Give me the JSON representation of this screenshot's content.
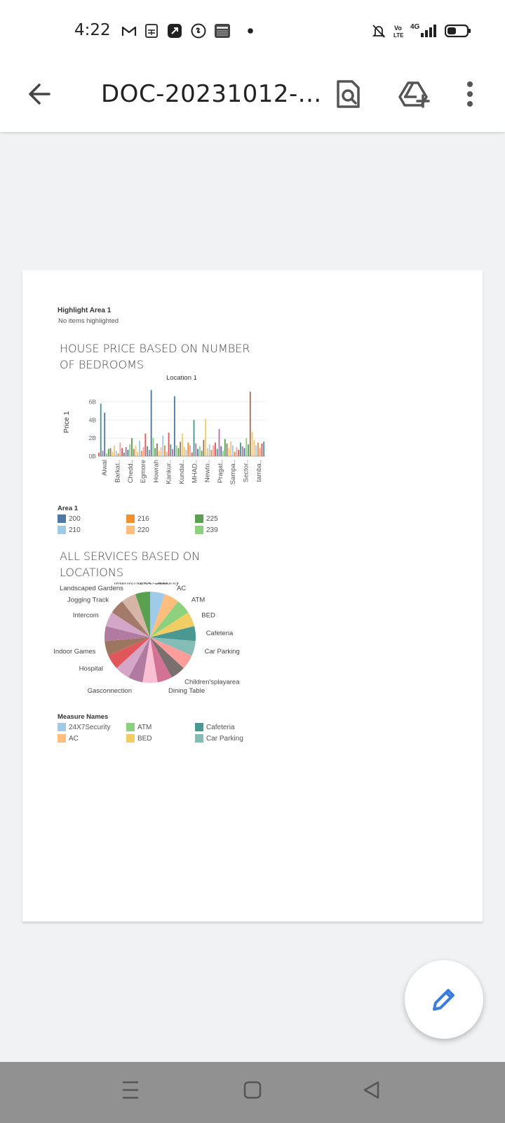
{
  "status_bar": {
    "time": "4:22",
    "network": "4G",
    "left_icons": [
      "gmail-icon",
      "sheets-icon",
      "app-icon",
      "shazam-icon",
      "news-icon",
      "dot-icon"
    ],
    "right_icons": [
      "mute-icon",
      "volte-icon",
      "signal-icon",
      "battery-icon"
    ]
  },
  "app_bar": {
    "title": "DOC-20231012-..."
  },
  "document": {
    "highlight": {
      "title": "Highlight Area 1",
      "subtitle": "No items highlighted"
    },
    "chart1_title": "HOUSE PRICE BASED ON NUMBER OF BEDROOMS",
    "chart2_title": "ALL SERVICES BASED ON LOCATIONS"
  },
  "chart_data": [
    {
      "type": "bar",
      "title": "Location 1",
      "ylabel": "Price 1",
      "y_ticks": [
        "0B",
        "2B",
        "4B",
        "6B"
      ],
      "ylim": [
        0,
        7.5
      ],
      "x_tick_labels": [
        "Alwal",
        "Barkat..",
        "Chedd..",
        "Egmore",
        "Howrah",
        "Kankur..",
        "Kundal..",
        "MHAD..",
        "Newto..",
        "Pragat..",
        "Sampa..",
        "Sector..",
        "tamba.."
      ],
      "values": [
        0.4,
        5.8,
        0.6,
        4.8,
        0.3,
        0.8,
        0.9,
        0.5,
        1.2,
        0.6,
        0.3,
        1.5,
        0.9,
        0.4,
        1.0,
        0.7,
        1.3,
        2.0,
        0.8,
        1.2,
        0.5,
        1.7,
        0.6,
        1.0,
        2.5,
        1.1,
        0.7,
        7.3,
        2.0,
        0.9,
        1.4,
        0.6,
        1.0,
        2.3,
        1.2,
        0.5,
        2.6,
        1.3,
        0.8,
        6.6,
        1.2,
        0.9,
        1.6,
        2.5,
        1.0,
        0.7,
        1.5,
        1.2,
        0.4,
        4.0,
        1.4,
        0.8,
        1.1,
        0.6,
        1.8,
        4.1,
        0.9,
        1.3,
        0.7,
        1.2,
        1.5,
        0.8,
        3.0,
        1.1,
        0.6,
        1.9,
        1.4,
        0.9,
        1.6,
        1.2,
        0.5,
        1.0,
        0.7,
        1.5,
        1.1,
        0.9,
        2.0,
        1.3,
        7.1,
        2.7,
        1.8,
        1.2,
        1.5,
        0.9,
        1.4,
        1.6
      ],
      "legend_title": "Area 1",
      "legend": [
        {
          "label": "200",
          "color": "#4e79a7"
        },
        {
          "label": "216",
          "color": "#f28e2b"
        },
        {
          "label": "225",
          "color": "#59a14f"
        },
        {
          "label": "210",
          "color": "#a0cbe8"
        },
        {
          "label": "220",
          "color": "#ffbe7d"
        },
        {
          "label": "239",
          "color": "#8cd17d"
        }
      ]
    },
    {
      "type": "pie",
      "slices": [
        {
          "label": "24X7Security",
          "value": 1,
          "color": "#a0cbe8"
        },
        {
          "label": "AC",
          "value": 1,
          "color": "#ffbe7d"
        },
        {
          "label": "ATM",
          "value": 1,
          "color": "#8cd17d"
        },
        {
          "label": "BED",
          "value": 1,
          "color": "#f1ce63"
        },
        {
          "label": "Cafeteria",
          "value": 1,
          "color": "#499894"
        },
        {
          "label": "Car Parking",
          "value": 1,
          "color": "#86bcb6"
        },
        {
          "label": "",
          "value": 1,
          "color": "#ff9d9a"
        },
        {
          "label": "Children'splayarea",
          "value": 1,
          "color": "#79706e"
        },
        {
          "label": "Dining Table",
          "value": 1,
          "color": "#d37295"
        },
        {
          "label": "",
          "value": 1,
          "color": "#fabfd2"
        },
        {
          "label": "Gasconnection",
          "value": 1,
          "color": "#b07aa1"
        },
        {
          "label": "",
          "value": 1,
          "color": "#d4a6c8"
        },
        {
          "label": "Hospital",
          "value": 1,
          "color": "#e15759"
        },
        {
          "label": "Indoor Games",
          "value": 1,
          "color": "#9d7660"
        },
        {
          "label": "",
          "value": 1,
          "color": "#b07aa1"
        },
        {
          "label": "Intercom",
          "value": 1,
          "color": "#d4a6c8"
        },
        {
          "label": "Jogging Track",
          "value": 1,
          "color": "#a47b6b"
        },
        {
          "label": "Landscaped Gardens",
          "value": 1,
          "color": "#d7b5a6"
        },
        {
          "label": "Maintenance Staff",
          "value": 1,
          "color": "#59a14f"
        }
      ],
      "legend_title": "Measure Names",
      "legend": [
        {
          "label": "24X7Security",
          "color": "#a0cbe8"
        },
        {
          "label": "ATM",
          "color": "#8cd17d"
        },
        {
          "label": "Cafeteria",
          "color": "#499894"
        },
        {
          "label": "AC",
          "color": "#ffbe7d"
        },
        {
          "label": "BED",
          "color": "#f1ce63"
        },
        {
          "label": "Car Parking",
          "color": "#86bcb6"
        }
      ]
    }
  ]
}
